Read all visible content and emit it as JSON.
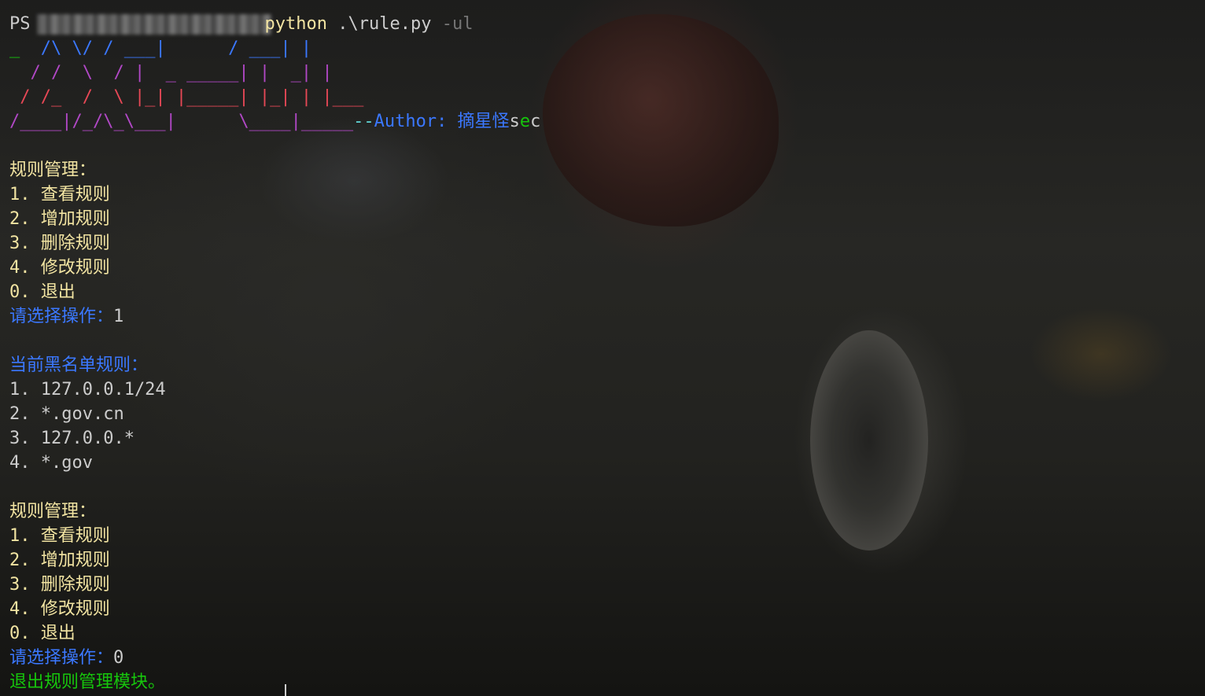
{
  "prompt": {
    "ps": "PS",
    "command": "python",
    "args": ".\\rule.py",
    "flag": "-ul"
  },
  "banner": {
    "line1": [
      {
        "t": "_  ",
        "c": "#16c60c"
      },
      {
        "t": "/\\ \\/ / ___|",
        "c": "#3b78ff"
      },
      {
        "t": "      / ___| |",
        "c": "#3b78ff"
      }
    ],
    "line2": [
      {
        "t": "  / /  \\  / |  _ _____| |  _| |",
        "c": "#b148c6"
      }
    ],
    "line3": [
      {
        "t": " / /_  /  \\ |_| |_____| |_| | |___",
        "c": "#e74856"
      }
    ],
    "line4": [
      {
        "t": "/____|/_/\\_\\___|      \\____|_____",
        "c": "#b148c6"
      }
    ],
    "author_prefix": "--",
    "author_label": "Author: 摘星怪",
    "author_s": "s",
    "author_e": "e",
    "author_c": "c"
  },
  "menu1": {
    "title": "规则管理：",
    "items": [
      "1. 查看规则",
      "2. 增加规则",
      "3. 删除规则",
      "4. 修改规则",
      "0. 退出"
    ],
    "prompt_label": "请选择操作：",
    "prompt_value": "1"
  },
  "rules": {
    "title": "当前黑名单规则：",
    "items": [
      "1. 127.0.0.1/24",
      "2. *.gov.cn",
      "3. 127.0.0.*",
      "4. *.gov"
    ]
  },
  "menu2": {
    "title": "规则管理：",
    "items": [
      "1. 查看规则",
      "2. 增加规则",
      "3. 删除规则",
      "4. 修改规则",
      "0. 退出"
    ],
    "prompt_label": "请选择操作：",
    "prompt_value": "0"
  },
  "exit_message": "退出规则管理模块。",
  "colors": {
    "yellow": "#f2e4a2",
    "blue": "#3b78ff",
    "green": "#16c60c",
    "white": "#cccccc",
    "grey": "#767676"
  }
}
